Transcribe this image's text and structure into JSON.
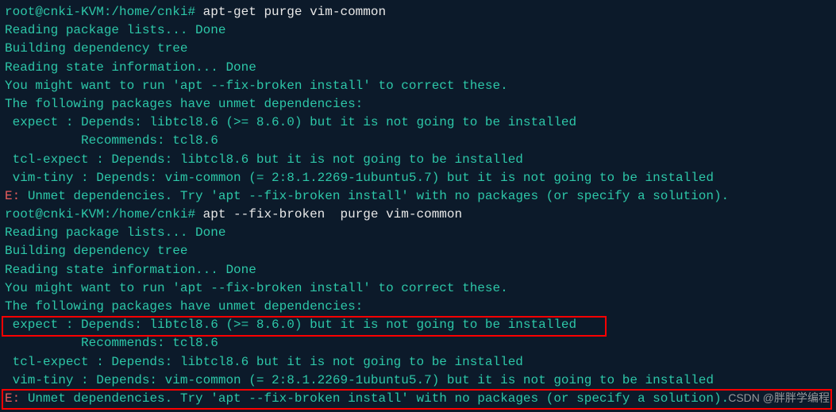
{
  "terminal": {
    "prompt1": "root@cnki-KVM:/home/cnki# ",
    "cmd1": "apt-get purge vim-common",
    "out1_1": "Reading package lists... Done",
    "out1_2": "Building dependency tree",
    "out1_3": "Reading state information... Done",
    "out1_4": "You might want to run 'apt --fix-broken install' to correct these.",
    "out1_5": "The following packages have unmet dependencies:",
    "out1_6": " expect : Depends: libtcl8.6 (>= 8.6.0) but it is not going to be installed",
    "out1_7": "          Recommends: tcl8.6",
    "out1_8": " tcl-expect : Depends: libtcl8.6 but it is not going to be installed",
    "out1_9": " vim-tiny : Depends: vim-common (= 2:8.1.2269-1ubuntu5.7) but it is not going to be installed",
    "err1_prefix": "E: ",
    "err1_text": "Unmet dependencies. Try 'apt --fix-broken install' with no packages (or specify a solution).",
    "prompt2": "root@cnki-KVM:/home/cnki# ",
    "cmd2": "apt --fix-broken  purge vim-common",
    "out2_1": "Reading package lists... Done",
    "out2_2": "Building dependency tree",
    "out2_3": "Reading state information... Done",
    "out2_4": "You might want to run 'apt --fix-broken install' to correct these.",
    "out2_5": "The following packages have unmet dependencies:",
    "out2_6": " expect : Depends: libtcl8.6 (>= 8.6.0) but it is not going to be installed",
    "out2_7": "          Recommends: tcl8.6",
    "out2_8": " tcl-expect : Depends: libtcl8.6 but it is not going to be installed",
    "out2_9": " vim-tiny : Depends: vim-common (= 2:8.1.2269-1ubuntu5.7) but it is not going to be installed",
    "err2_prefix": "E: ",
    "err2_text": "Unmet dependencies. Try 'apt --fix-broken install' with no packages (or specify a solution)."
  },
  "watermark": "CSDN @胖胖学编程"
}
